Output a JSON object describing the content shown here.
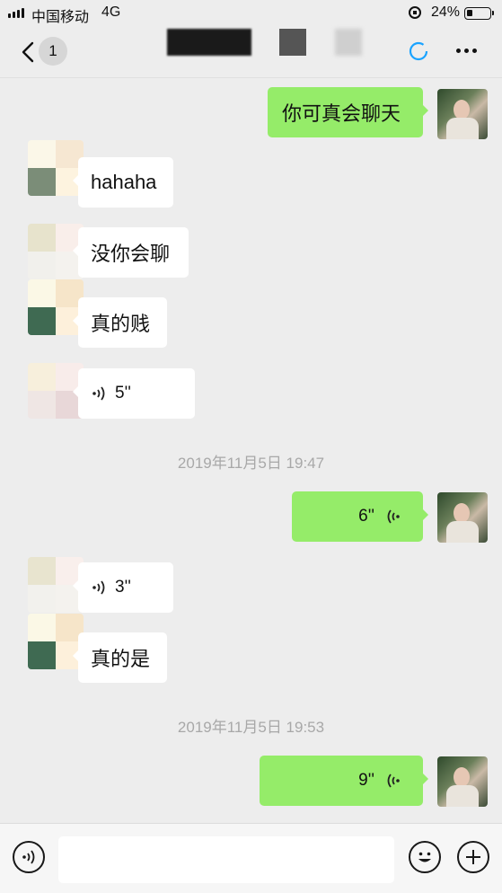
{
  "status_bar": {
    "carrier": "中国移动",
    "network": "4G",
    "battery_percent": "24%",
    "battery_level": 0.24
  },
  "nav": {
    "unread_count": "1",
    "icons": {
      "back": "chevron-left-icon",
      "sync": "loading-ring-icon",
      "more": "more-dots-icon"
    }
  },
  "messages": [
    {
      "side": "out",
      "type": "text",
      "text": "你可真会聊天"
    },
    {
      "side": "in",
      "type": "text",
      "text": "hahaha"
    },
    {
      "side": "in",
      "type": "text",
      "text": "没你会聊"
    },
    {
      "side": "in",
      "type": "text",
      "text": "真的贱"
    },
    {
      "side": "in",
      "type": "voice",
      "duration": "5''"
    },
    {
      "type": "timestamp",
      "text": "2019年11月5日 19:47"
    },
    {
      "side": "out",
      "type": "voice",
      "duration": "6''"
    },
    {
      "side": "in",
      "type": "voice",
      "duration": "3''"
    },
    {
      "side": "in",
      "type": "text",
      "text": "真的是"
    },
    {
      "type": "timestamp",
      "text": "2019年11月5日 19:53"
    },
    {
      "side": "out",
      "type": "voice",
      "duration": "9''"
    }
  ],
  "input_bar": {
    "input_value": "",
    "icons": {
      "voice": "voice-mode-icon",
      "emoji": "emoji-icon",
      "add": "plus-icon"
    }
  },
  "colors": {
    "background": "#ededed",
    "outgoing_bubble": "#95ec69",
    "incoming_bubble": "#ffffff",
    "timestamp": "#a8a8a8",
    "accent": "#1aa3ff"
  }
}
